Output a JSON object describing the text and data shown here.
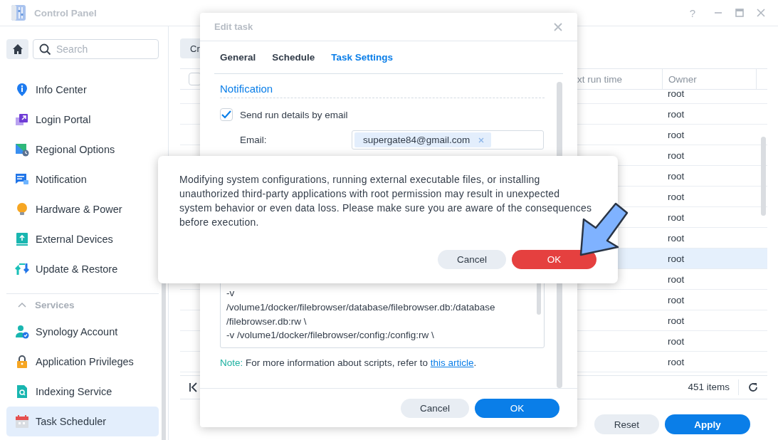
{
  "window": {
    "title": "Control Panel",
    "help": "?"
  },
  "sidebar": {
    "search": {
      "placeholder": "Search"
    },
    "items": [
      {
        "label": "Info Center",
        "selected": false
      },
      {
        "label": "Login Portal",
        "selected": false
      },
      {
        "label": "Regional Options",
        "selected": false
      },
      {
        "label": "Notification",
        "selected": false
      },
      {
        "label": "Hardware & Power",
        "selected": false
      },
      {
        "label": "External Devices",
        "selected": false
      },
      {
        "label": "Update & Restore",
        "selected": false
      }
    ],
    "section": {
      "label": "Services",
      "expanded": true,
      "items": [
        {
          "label": "Synology Account",
          "selected": false
        },
        {
          "label": "Application Privileges",
          "selected": false
        },
        {
          "label": "Indexing Service",
          "selected": false
        },
        {
          "label": "Task Scheduler",
          "selected": true
        }
      ]
    }
  },
  "main": {
    "create_button": "Cr",
    "table": {
      "select_all": {
        "checked": false
      },
      "columns": [
        "xt run time",
        "Owner"
      ],
      "rows": [
        {
          "owner": "root",
          "selected": false
        },
        {
          "owner": "root",
          "selected": false
        },
        {
          "owner": "root",
          "selected": false
        },
        {
          "owner": "root",
          "selected": false
        },
        {
          "owner": "root",
          "selected": false
        },
        {
          "owner": "root",
          "selected": false
        },
        {
          "owner": "root",
          "selected": false
        },
        {
          "owner": "root",
          "selected": false
        },
        {
          "owner": "root",
          "selected": true
        },
        {
          "owner": "root",
          "selected": false
        },
        {
          "owner": "root",
          "selected": false
        },
        {
          "owner": "root",
          "selected": false
        },
        {
          "owner": "root",
          "selected": false
        },
        {
          "owner": "root",
          "selected": false
        }
      ]
    },
    "item_count": "451 items",
    "buttons": [
      {
        "label": "Reset",
        "kind": "secondary"
      },
      {
        "label": "Apply",
        "kind": "primary"
      }
    ]
  },
  "edit_task": {
    "title": "Edit task",
    "tabs": [
      {
        "label": "General",
        "selected": false
      },
      {
        "label": "Schedule",
        "selected": false
      },
      {
        "label": "Task Settings",
        "selected": true
      }
    ],
    "section": "Notification",
    "send_email": {
      "label": "Send run details by email",
      "checked": true
    },
    "email": {
      "label": "Email:",
      "value": "supergate84@gmail.com"
    },
    "script_lines": [
      "-v",
      "/volume1/docker/filebrowser/database/filebrowser.db:/database",
      "/filebrowser.db:rw \\",
      "-v /volume1/docker/filebrowser/config:/config:rw \\"
    ],
    "note": {
      "label": "Note:",
      "text": "For more information about scripts, refer to",
      "link": "this article",
      "end": "."
    },
    "buttons": [
      {
        "label": "Cancel",
        "kind": "secondary"
      },
      {
        "label": "OK",
        "kind": "primary"
      }
    ]
  },
  "alert": {
    "message": "Modifying system configurations, running external executable files, or installing unauthorized third-party applications with root permission may result in unexpected system behavior or even data loss. Please make sure you are aware of the consequences before execution.",
    "buttons": [
      {
        "label": "Cancel",
        "kind": "secondary"
      },
      {
        "label": "OK",
        "kind": "danger"
      }
    ]
  }
}
